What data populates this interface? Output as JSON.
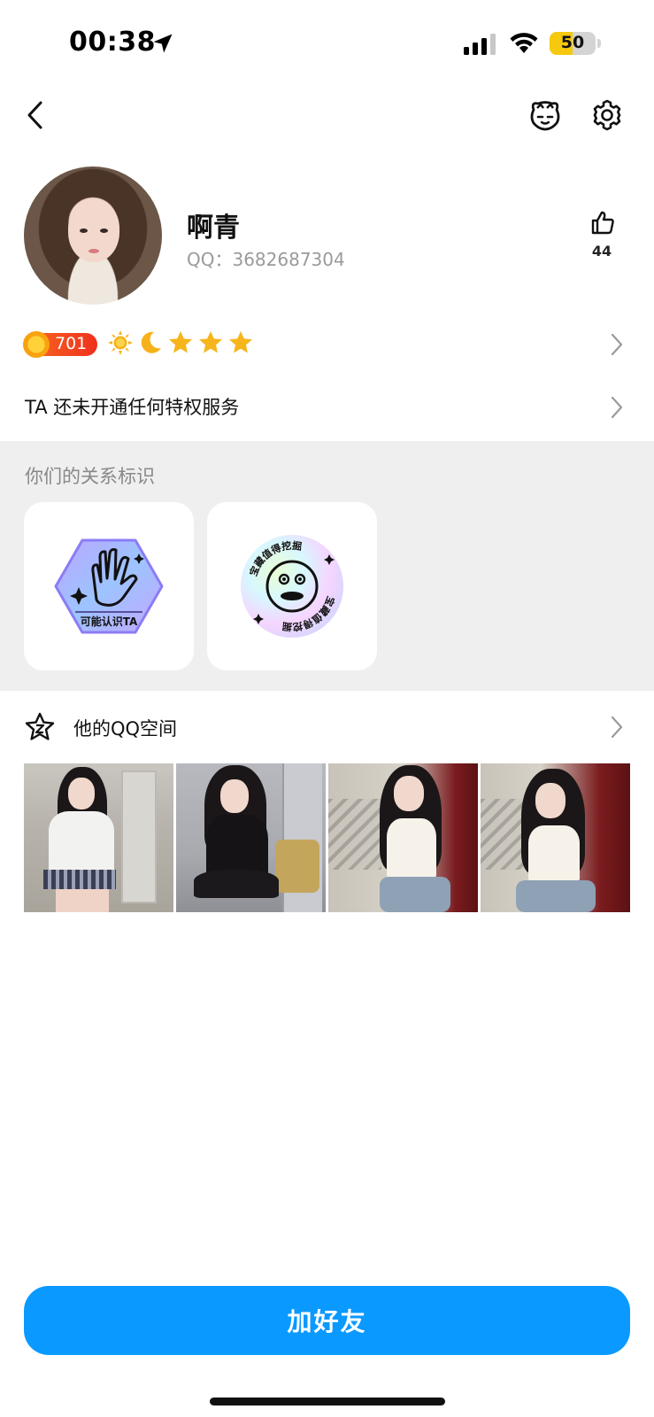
{
  "status_bar": {
    "time": "00:38",
    "battery": "50",
    "battery_level": 0.5
  },
  "profile": {
    "name": "啊青",
    "qq": "QQ：3682687304",
    "like_count": "44"
  },
  "level": {
    "value": "701",
    "icons": [
      "sun-icon",
      "moon-icon",
      "star-icon",
      "star-icon",
      "star-icon"
    ]
  },
  "privilege": {
    "text": "TA 还未开通任何特权服务"
  },
  "relationship": {
    "title": "你们的关系标识",
    "cards": [
      {
        "icon": "wave-hand-badge-icon",
        "label": "可能认识TA"
      },
      {
        "icon": "smiley-badge-icon",
        "label": "宝藏值得挖掘"
      }
    ]
  },
  "qzone": {
    "title": "他的QQ空间"
  },
  "actions": {
    "add_friend": "加好友"
  },
  "colors": {
    "accent": "#0a99ff",
    "section_bg": "#efefef",
    "level_badge": "#f0301e"
  }
}
